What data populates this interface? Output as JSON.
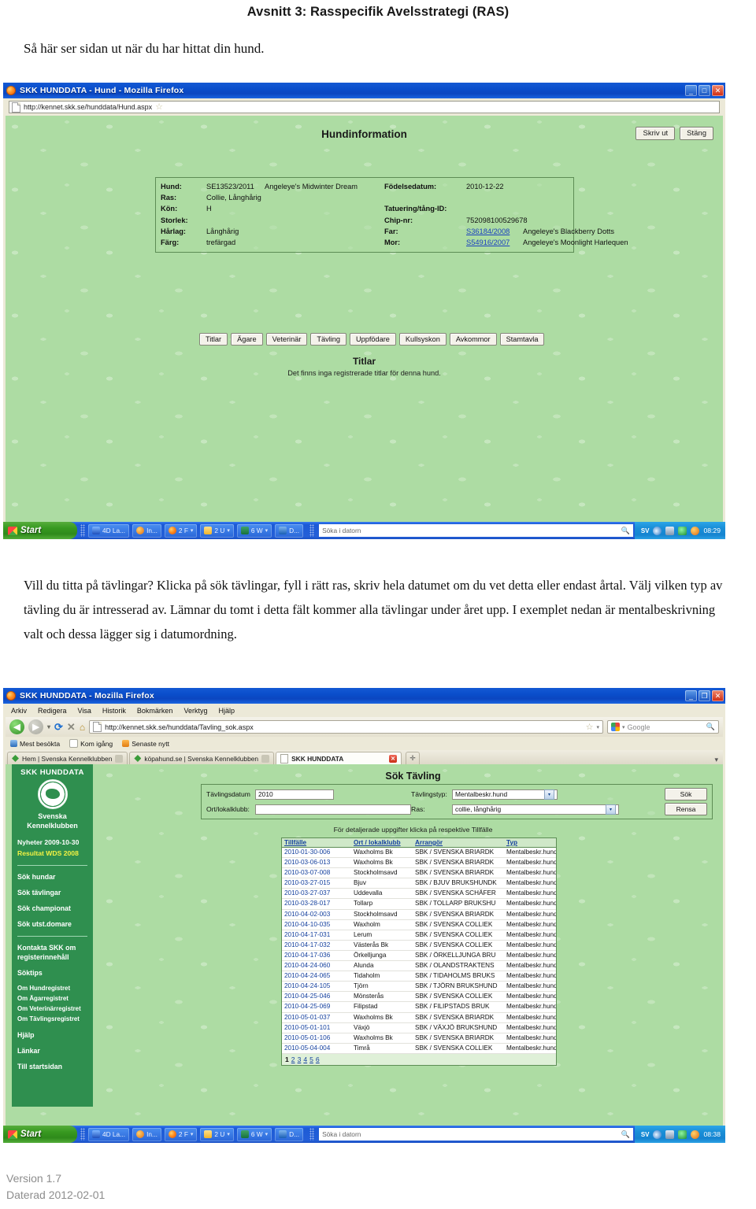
{
  "document": {
    "title": "Avsnitt 3: Rasspecifik Avelsstrategi (RAS)",
    "intro": "Så här ser sidan ut när du har hittat din hund.",
    "paragraph": "Vill du titta på tävlingar? Klicka på sök tävlingar, fyll i rätt ras, skriv hela datumet om du vet detta eller endast årtal. Välj vilken typ av tävling du är intresserad av. Lämnar du tomt i detta fält kommer alla tävlingar under året upp. I exemplet nedan är mentalbeskrivning valt och dessa lägger sig i datumordning.",
    "footer_version": "Version 1.7",
    "footer_date": "Daterad 2012-02-01"
  },
  "window1": {
    "title": "SKK HUNDDATA - Hund - Mozilla Firefox",
    "url": "http://kennet.skk.se/hunddata/Hund.aspx",
    "minimize": "_",
    "maximize": "□",
    "close": "✕",
    "star_icon": "☆",
    "page_heading": "Hundinformation",
    "buttons": {
      "print": "Skriv ut",
      "close": "Stäng"
    },
    "info": {
      "hund_label": "Hund:",
      "hund_reg": "SE13523/2011",
      "hund_name": "Angeleye's Midwinter Dream",
      "fodelsedatum_label": "Födelsedatum:",
      "fodelsedatum": "2010-12-22",
      "ras_label": "Ras:",
      "ras": "Collie, Långhårig",
      "kon_label": "Kön:",
      "kon": "H",
      "tatuering_label": "Tatuering/tång-ID:",
      "tatuering": "",
      "storlek_label": "Storlek:",
      "storlek": "",
      "chip_label": "Chip-nr:",
      "chip": "752098100529678",
      "harlag_label": "Hårlag:",
      "harlag": "Långhårig",
      "far_label": "Far:",
      "far_reg": "S36184/2008",
      "far_name": "Angeleye's Blackberry Dotts",
      "farg_label": "Färg:",
      "farg": "trefärgad",
      "mor_label": "Mor:",
      "mor_reg": "S54916/2007",
      "mor_name": "Angeleye's Moonlight Harlequen"
    },
    "tabs": [
      "Titlar",
      "Ägare",
      "Veterinär",
      "Tävling",
      "Uppfödare",
      "Kullsyskon",
      "Avkommor",
      "Stamtavla"
    ],
    "section_heading": "Titlar",
    "section_text": "Det finns inga registrerade titlar för denna hund.",
    "taskbar": {
      "start": "Start",
      "items": [
        {
          "icon": "app-icon",
          "label": "4D La...",
          "caret": ""
        },
        {
          "icon": "messenger-icon",
          "label": "In...",
          "caret": ""
        },
        {
          "icon": "firefox-icon",
          "label": "2 F",
          "caret": "▾"
        },
        {
          "icon": "folder-icon",
          "label": "2 U",
          "caret": "▾"
        },
        {
          "icon": "excel-icon",
          "label": "6 W",
          "caret": "▾"
        },
        {
          "icon": "word-icon",
          "label": "D...",
          "caret": ""
        }
      ],
      "search_placeholder": "Söka i datorn",
      "search_icon": "🔍",
      "lang": "SV",
      "clock": "08:29"
    }
  },
  "window2": {
    "title": "SKK HUNDDATA - Mozilla Firefox",
    "minimize": "_",
    "maximize": "❐",
    "close": "✕",
    "menus": [
      "Arkiv",
      "Redigera",
      "Visa",
      "Historik",
      "Bokmärken",
      "Verktyg",
      "Hjälp"
    ],
    "nav": {
      "back_icon": "◀",
      "forward_icon": "▶",
      "dropdown_icon": "▾",
      "reload_icon": "⟳",
      "stop_icon": "✕",
      "home_icon": "⌂",
      "url": "http://kennet.skk.se/hunddata/Tavling_sok.aspx",
      "bookmark_star": "☆",
      "bookmark_caret": "▾",
      "search_placeholder": "Google",
      "search_icon": "🔍",
      "google_caret": "▾"
    },
    "bookmarks": [
      "Mest besökta",
      "Kom igång",
      "Senaste nytt"
    ],
    "tabs": [
      {
        "label": "Hem | Svenska Kennelklubben",
        "active": false
      },
      {
        "label": "köpahund.se | Svenska Kennelklubben",
        "active": false
      },
      {
        "label": "SKK HUNDDATA",
        "active": true
      }
    ],
    "tab_close": "✕",
    "tab_new": "✛",
    "tab_list_icon": "▾",
    "sidebar": {
      "title": "SKK HUNDDATA",
      "org_line1": "Svenska",
      "org_line2": "Kennelklubben",
      "news1": "Nyheter  2009-10-30",
      "news2": "Resultat WDS 2008",
      "links_main": [
        "Sök hundar",
        "Sök tävlingar",
        "Sök championat",
        "Sök utst.domare"
      ],
      "contact": "Kontakta SKK om registerinnehåll",
      "tips": "Söktips",
      "links_about": [
        "Om Hundregistret",
        "Om Ägarregistret",
        "Om Veterinärregistret",
        "Om Tävlingsregistret"
      ],
      "help": "Hjälp",
      "links": "Länkar",
      "start": "Till startsidan"
    },
    "search": {
      "heading": "Sök Tävling",
      "date_label": "Tävlingsdatum",
      "date_value": "2010",
      "place_label": "Ort/lokalklubb:",
      "place_value": "",
      "type_label": "Tävlingstyp:",
      "type_value": "Mentalbeskr.hund",
      "breed_label": "Ras:",
      "breed_value": "collie, långhårig",
      "search_button": "Sök",
      "clear_button": "Rensa",
      "select_arrow": "▾"
    },
    "hint": "För detaljerade uppgifter klicka på respektive Tillfälle",
    "table": {
      "columns": [
        "Tillfälle",
        "Ort / lokalklubb",
        "Arrangör",
        "Typ"
      ],
      "rows": [
        [
          "2010-01-30-006",
          "Waxholms Bk",
          "SBK / SVENSKA BRIARDK",
          "Mentalbeskr.hund"
        ],
        [
          "2010-03-06-013",
          "Waxholms Bk",
          "SBK / SVENSKA BRIARDK",
          "Mentalbeskr.hund"
        ],
        [
          "2010-03-07-008",
          "Stockholmsavd",
          "SBK / SVENSKA BRIARDK",
          "Mentalbeskr.hund"
        ],
        [
          "2010-03-27-015",
          "Bjuv",
          "SBK / BJUV BRUKSHUNDK",
          "Mentalbeskr.hund"
        ],
        [
          "2010-03-27-037",
          "Uddevalla",
          "SBK / SVENSKA SCHÄFER",
          "Mentalbeskr.hund"
        ],
        [
          "2010-03-28-017",
          "Tollarp",
          "SBK / TOLLARP BRUKSHU",
          "Mentalbeskr.hund"
        ],
        [
          "2010-04-02-003",
          "Stockholmsavd",
          "SBK / SVENSKA BRIARDK",
          "Mentalbeskr.hund"
        ],
        [
          "2010-04-10-035",
          "Waxholm",
          "SBK / SVENSKA COLLIEK",
          "Mentalbeskr.hund"
        ],
        [
          "2010-04-17-031",
          "Lerum",
          "SBK / SVENSKA COLLIEK",
          "Mentalbeskr.hund"
        ],
        [
          "2010-04-17-032",
          "Västerås Bk",
          "SBK / SVENSKA COLLIEK",
          "Mentalbeskr.hund"
        ],
        [
          "2010-04-17-036",
          "Örkelljunga",
          "SBK / ÖRKELLJUNGA BRU",
          "Mentalbeskr.hund"
        ],
        [
          "2010-04-24-060",
          "Alunda",
          "SBK / OLANDSTRAKTENS",
          "Mentalbeskr.hund"
        ],
        [
          "2010-04-24-065",
          "Tidaholm",
          "SBK / TIDAHOLMS BRUKS",
          "Mentalbeskr.hund"
        ],
        [
          "2010-04-24-105",
          "Tjörn",
          "SBK / TJÖRN BRUKSHUND",
          "Mentalbeskr.hund"
        ],
        [
          "2010-04-25-046",
          "Mönsterås",
          "SBK / SVENSKA COLLIEK",
          "Mentalbeskr.hund"
        ],
        [
          "2010-04-25-069",
          "Filipstad",
          "SBK / FILIPSTADS BRUK",
          "Mentalbeskr.hund"
        ],
        [
          "2010-05-01-037",
          "Waxholms Bk",
          "SBK / SVENSKA BRIARDK",
          "Mentalbeskr.hund"
        ],
        [
          "2010-05-01-101",
          "Växjö",
          "SBK / VÄXJÖ BRUKSHUND",
          "Mentalbeskr.hund"
        ],
        [
          "2010-05-01-106",
          "Waxholms Bk",
          "SBK / SVENSKA BRIARDK",
          "Mentalbeskr.hund"
        ],
        [
          "2010-05-04-004",
          "Timrå",
          "SBK / SVENSKA COLLIEK",
          "Mentalbeskr.hund"
        ]
      ],
      "pages": [
        "1",
        "2",
        "3",
        "4",
        "5",
        "6"
      ],
      "current_page": "1"
    },
    "taskbar": {
      "start": "Start",
      "items": [
        {
          "icon": "app-icon",
          "label": "4D La...",
          "caret": ""
        },
        {
          "icon": "messenger-icon",
          "label": "In...",
          "caret": ""
        },
        {
          "icon": "firefox-icon",
          "label": "2 F",
          "caret": "▾"
        },
        {
          "icon": "folder-icon",
          "label": "2 U",
          "caret": "▾"
        },
        {
          "icon": "excel-icon",
          "label": "6 W",
          "caret": "▾"
        },
        {
          "icon": "word-icon",
          "label": "D...",
          "caret": ""
        }
      ],
      "search_placeholder": "Söka i datorn",
      "search_icon": "🔍",
      "lang": "SV",
      "clock": "08:38"
    }
  }
}
